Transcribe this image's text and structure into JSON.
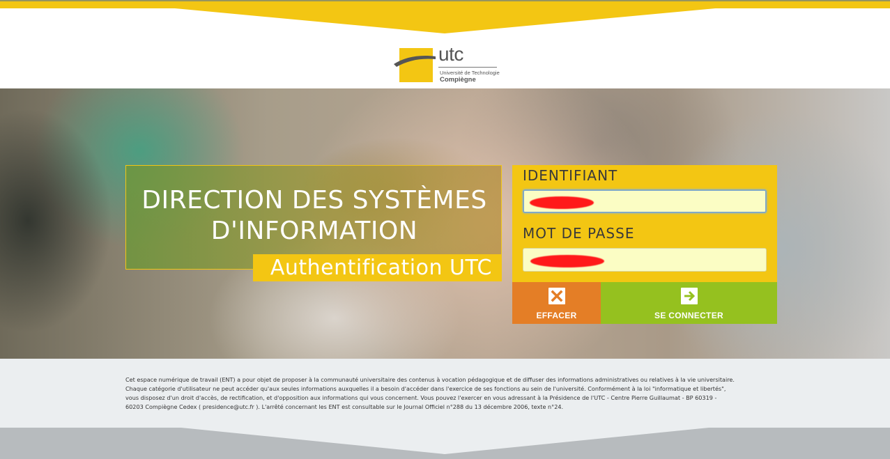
{
  "colors": {
    "brand_yellow": "#f3c613",
    "clear_orange": "#e47e26",
    "connect_green": "#95c11f",
    "input_bg": "#fbfdc4",
    "footer_bg": "#ebeef0",
    "footer_band": "#b7bbbe"
  },
  "logo": {
    "name": "utc",
    "line1": "Université de Technologie",
    "line2": "Compiègne"
  },
  "hero": {
    "title_line1": "DIRECTION DES SYSTÈMES",
    "title_line2": "D'INFORMATION",
    "subtitle": "Authentification UTC"
  },
  "login": {
    "username_label": "IDENTIFIANT",
    "password_label": "MOT DE PASSE",
    "clear_button": "EFFACER",
    "connect_button": "SE CONNECTER",
    "clear_icon": "close-icon",
    "connect_icon": "arrow-right-icon"
  },
  "legal": {
    "lines": [
      "Cet espace numérique de travail (ENT) a pour objet de proposer à la communauté universitaire des contenus à vocation pédagogique et de diffuser des informations administratives ou relatives à la vie universitaire.",
      "Chaque catégorie d'utilisateur ne peut accéder qu'aux seules informations auxquelles il a besoin d'accéder dans l'exercice de ses fonctions au sein de l'université. Conformément à la loi \"informatique et libertés\",",
      "vous disposez d'un droit d'accès, de rectification, et d'opposition aux informations qui vous concernent. Vous pouvez l'exercer en vous adressant à la Présidence de l'UTC - Centre Pierre Guillaumat - BP 60319 -",
      "60203 Compiègne Cedex ( presidence@utc.fr ). L'arrêté concernant les ENT est consultable sur le Journal Officiel n°288 du 13 décembre 2006, texte n°24."
    ]
  }
}
